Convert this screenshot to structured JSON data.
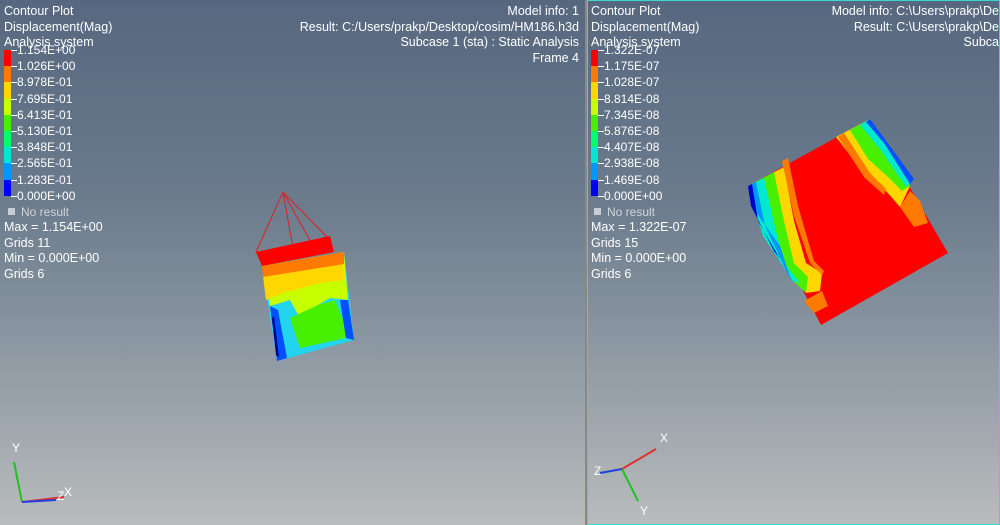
{
  "left": {
    "header": {
      "line1": "Contour Plot",
      "line2": "Displacement(Mag)",
      "line3": "Analysis system"
    },
    "legend_values": [
      "1.154E+00",
      "1.026E+00",
      "8.978E-01",
      "7.695E-01",
      "6.413E-01",
      "5.130E-01",
      "3.848E-01",
      "2.565E-01",
      "1.283E-01",
      "0.000E+00"
    ],
    "no_result": "No result",
    "stats": {
      "max": "Max = 1.154E+00",
      "max_grid": "Grids 11",
      "min": "Min = 0.000E+00",
      "min_grid": "Grids 6"
    },
    "info": {
      "model": "Model info: 1",
      "result": "Result: C:/Users/prakp/Desktop/cosim/HM186.h3d",
      "subcase": "Subcase 1 (sta) : Static Analysis",
      "frame": "Frame 4"
    },
    "axes": {
      "x": "X",
      "y": "Y",
      "z": "Z"
    }
  },
  "right": {
    "header": {
      "line1": "Contour Plot",
      "line2": "Displacement(Mag)",
      "line3": "Analysis system"
    },
    "legend_values": [
      "1.322E-07",
      "1.175E-07",
      "1.028E-07",
      "8.814E-08",
      "7.345E-08",
      "5.876E-08",
      "4.407E-08",
      "2.938E-08",
      "1.469E-08",
      "0.000E+00"
    ],
    "no_result": "No result",
    "stats": {
      "max": "Max = 1.322E-07",
      "max_grid": "Grids 15",
      "min": "Min = 0.000E+00",
      "min_grid": "Grids 6"
    },
    "info": {
      "model": "Model info: C:\\Users\\prakp\\De",
      "result": "Result: C:\\Users\\prakp\\De",
      "subcase": "Subca"
    },
    "axes": {
      "x": "X",
      "y": "Y",
      "z": "Z"
    }
  },
  "legend_colors": [
    "#ff0000",
    "#ff7a00",
    "#ffd700",
    "#c8ff00",
    "#46f000",
    "#00ff6a",
    "#00e8d0",
    "#0096ff",
    "#0000ff"
  ],
  "colors": {
    "mesh_edge": "#ff2020",
    "background_top": "#56677f",
    "background_bottom": "#b9bcbc",
    "active_border": "#3ad6d0"
  }
}
